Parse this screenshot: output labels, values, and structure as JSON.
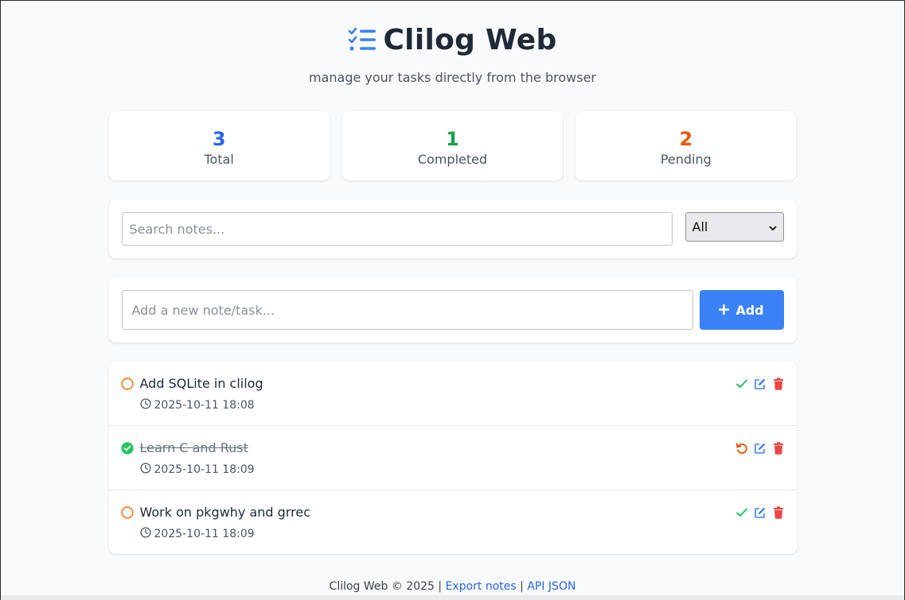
{
  "header": {
    "title": "Clilog Web",
    "subtitle": "manage your tasks directly from the browser",
    "icon": "list-check-icon"
  },
  "stats": [
    {
      "value": "3",
      "label": "Total",
      "color": "#2563eb"
    },
    {
      "value": "1",
      "label": "Completed",
      "color": "#16a34a"
    },
    {
      "value": "2",
      "label": "Pending",
      "color": "#ea580c"
    }
  ],
  "filter": {
    "search_placeholder": "Search notes...",
    "select_value": "All"
  },
  "add": {
    "placeholder": "Add a new note/task...",
    "button_label": "Add"
  },
  "tasks": [
    {
      "title": "Add SQLite in clilog",
      "date": "2025-10-11 18:08",
      "completed": false
    },
    {
      "title": "Learn C and Rust",
      "date": "2025-10-11 18:09",
      "completed": true
    },
    {
      "title": "Work on pkgwhy and grrec",
      "date": "2025-10-11 18:09",
      "completed": false
    }
  ],
  "footer": {
    "text": "Clilog Web © 2025 |",
    "sep": "|",
    "export_link": "Export notes",
    "api_link": "API JSON"
  },
  "colors": {
    "accent": "#3b82f6",
    "pending": "#f97316",
    "done": "#22c55e",
    "edit": "#3b82f6",
    "delete": "#ef4444"
  }
}
